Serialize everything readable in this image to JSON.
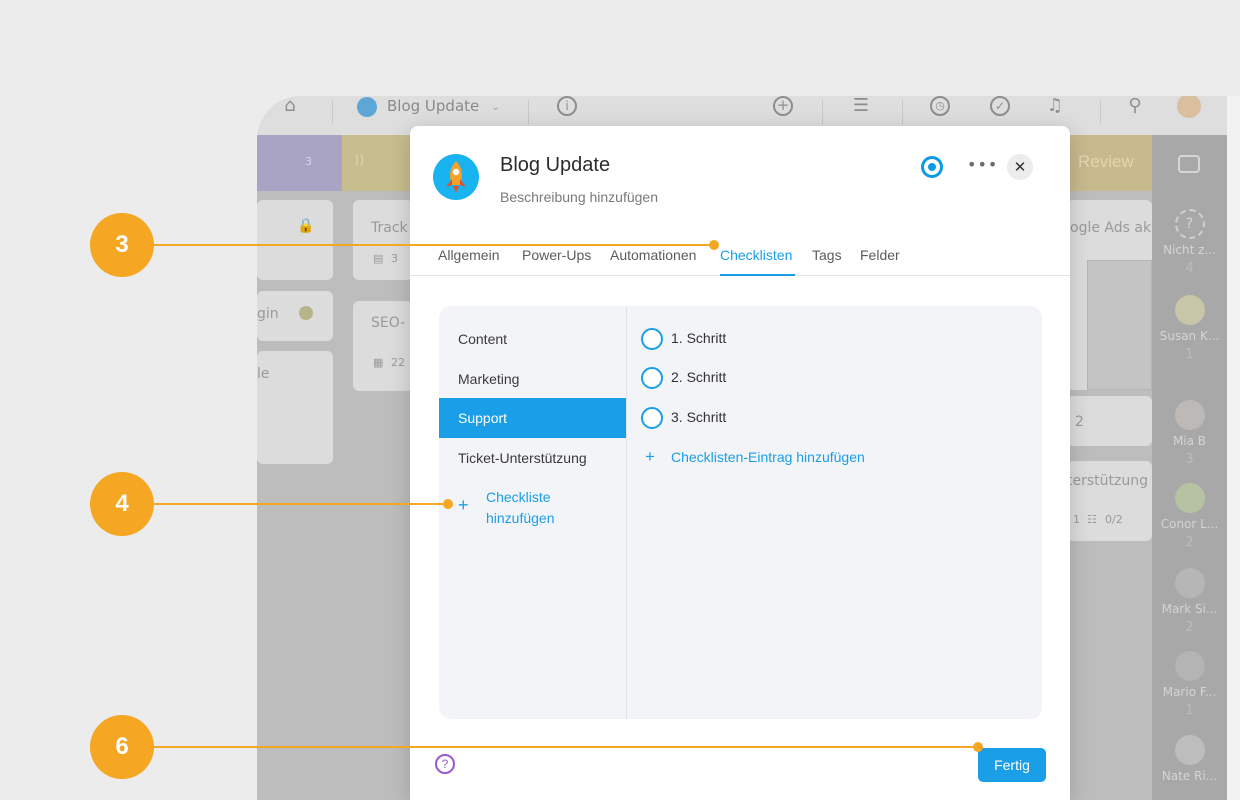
{
  "app": {
    "project_name": "Blog Update",
    "project_chevron": "⌄",
    "icons": [
      "home-icon",
      "info-icon",
      "add-icon",
      "gantt-icon",
      "timer-icon",
      "check-icon",
      "bell-icon",
      "search-icon"
    ],
    "column_count": "3",
    "review_label": "Review",
    "cards": {
      "c1": "Track",
      "c1_count": "3",
      "c2": "SEO-",
      "c2_count": "22",
      "c3": "gin",
      "c4": "le",
      "c5": "ogle Ads ak",
      "c6": "2",
      "c7": "terstützung",
      "c7_meta": "1",
      "c7_progress": "0/2"
    },
    "people": [
      {
        "name": "Nicht z...",
        "count": "4"
      },
      {
        "name": "Susan K...",
        "count": "1"
      },
      {
        "name": "Mia B",
        "count": "3"
      },
      {
        "name": "Conor L...",
        "count": "2"
      },
      {
        "name": "Mark Si...",
        "count": "2"
      },
      {
        "name": "Mario F...",
        "count": "1"
      },
      {
        "name": "Nate Ri...",
        "count": ""
      }
    ]
  },
  "modal": {
    "title": "Blog Update",
    "description": "Beschreibung hinzufügen",
    "more_label": "•••",
    "close_label": "✕",
    "tabs": [
      "Allgemein",
      "Power-Ups",
      "Automationen",
      "Checklisten",
      "Tags",
      "Felder"
    ],
    "active_tab": "Checklisten",
    "checklists": [
      "Content",
      "Marketing",
      "Support",
      "Ticket-Unterstützung"
    ],
    "active_checklist": "Support",
    "add_checklist_plus": "+",
    "add_checklist": "Checkliste hinzufügen",
    "steps": [
      "1. Schritt",
      "2. Schritt",
      "3. Schritt"
    ],
    "add_step_plus": "+",
    "add_step": "Checklisten-Eintrag hinzufügen",
    "help_label": "?",
    "done_label": "Fertig"
  },
  "callouts": [
    "3",
    "4",
    "6"
  ],
  "colors": {
    "accent": "#1a9ee8",
    "callout": "#f5a623",
    "help": "#9b59d0"
  }
}
